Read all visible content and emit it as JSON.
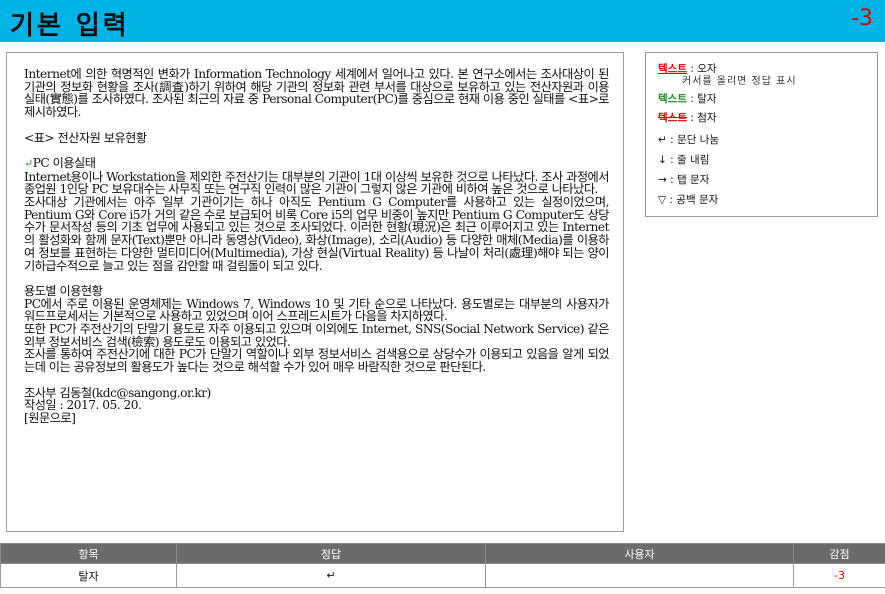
{
  "header": {
    "title": "기본 입력",
    "score": "-3"
  },
  "document": {
    "paragraphs": [
      "Internet에 의한 혁명적인 변화가 Information Technology 세계에서 일어나고 있다. 본 연구소에서는 조사대상이 된 기관의 정보화 현황을 조사(調査)하기 위하여 해당 기관의 정보화 관련 부서를 대상으로 보유하고 있는 전산자원과 이용 실태(實態)를 조사하였다. 조사된 최근의 자료 중 Personal Computer(PC)를 중심으로 현재 이용 중인 실태를 <표>로 제시하였다.",
      "",
      "<표> 전산자원 보유현황",
      "",
      "PC 이용실태",
      "Internet용이나 Workstation을 제외한 주전산기는 대부분의 기관이 1대 이상씩 보유한 것으로 나타났다. 조사 과정에서 종업원 1인당 PC 보유대수는 사무직 또는 연구직 인력이 많은 기관이 그렇지 않은 기관에 비하여 높은 것으로 나타났다.",
      "조사대상 기관에서는 아주 일부 기관이기는 하나 아직도 Pentium G Computer를 사용하고 있는 실정이었으며, Pentium G와 Core i5가 거의 같은 수로 보급되어 비록 Core i5의 업무 비중이 높지만 Pentium G Computer도 상당수가 문서작성 등의 기초 업무에 사용되고 있는 것으로 조사되었다. 이러한 현황(現況)은 최근 이루어지고 있는 Internet의 활성화와 함께 문자(Text)뿐만 아니라 동영상(Video), 화상(Image), 소리(Audio) 등 다양한 매체(Media)를 이용하여 정보를 표현하는 다양한 멀티미디어(Multimedia), 가상 현실(Virtual Reality) 등 나날이 처리(處理)해야 되는 양이 기하급수적으로 늘고 있는 점을 감안할 때 걸림돌이 되고 있다.",
      "",
      "용도별 이용현황",
      "PC에서 주로 이용된 운영체제는 Windows 7, Windows 10 및 기타 순으로 나타났다. 용도별로는 대부분의 사용자가 워드프로세서는 기본적으로 사용하고 있었으며 이어 스프레드시트가 다음을 차지하였다.",
      "또한 PC가 주전산기의 단말기 용도로 자주 이용되고 있으며 이외에도 Internet, SNS(Social Network Service) 같은 외부 정보서비스 검색(檢索) 용도로도 이용되고 있었다.",
      "조사를 통하여 주전산기에 대한 PC가 단말기 역할이나 외부 정보서비스 검색용으로 상당수가 이용되고 있음을 알게 되었는데 이는 공유정보의 활용도가 높다는 것으로 해석할 수가 있어 매우 바람직한 것으로 판단된다.",
      "",
      "조사부 김동철(kdc@sangong.or.kr)",
      "작성일 : 2017. 05. 20.",
      "[원문으로]"
    ],
    "enter_mark": "↵"
  },
  "legend": {
    "typo_word": "텍스트",
    "typo_desc": ": 오자",
    "typo_hint": "커서를 올리면 정답 표시",
    "missing_word": "텍스트",
    "missing_desc": ": 탈자",
    "extra_word": "텍스트",
    "extra_desc": ": 첨자",
    "paragraph_mark": "↵",
    "paragraph_desc": ": 문단 나눔",
    "linebreak_mark": "↓",
    "linebreak_desc": ": 줄 내림",
    "tab_mark": "→",
    "tab_desc": ": 탭 문자",
    "space_mark": "▽",
    "space_desc": ": 공백 문자"
  },
  "result_table": {
    "headers": [
      "항목",
      "정답",
      "사용자",
      "감점"
    ],
    "rows": [
      [
        "탈자",
        "↵",
        "",
        "-3"
      ]
    ]
  },
  "colors": {
    "header_bg": "#00b3e6",
    "score": "#e00000",
    "typo": "#d40000",
    "missing": "#1f8a1f",
    "table_header_bg": "#6b6b6b"
  }
}
